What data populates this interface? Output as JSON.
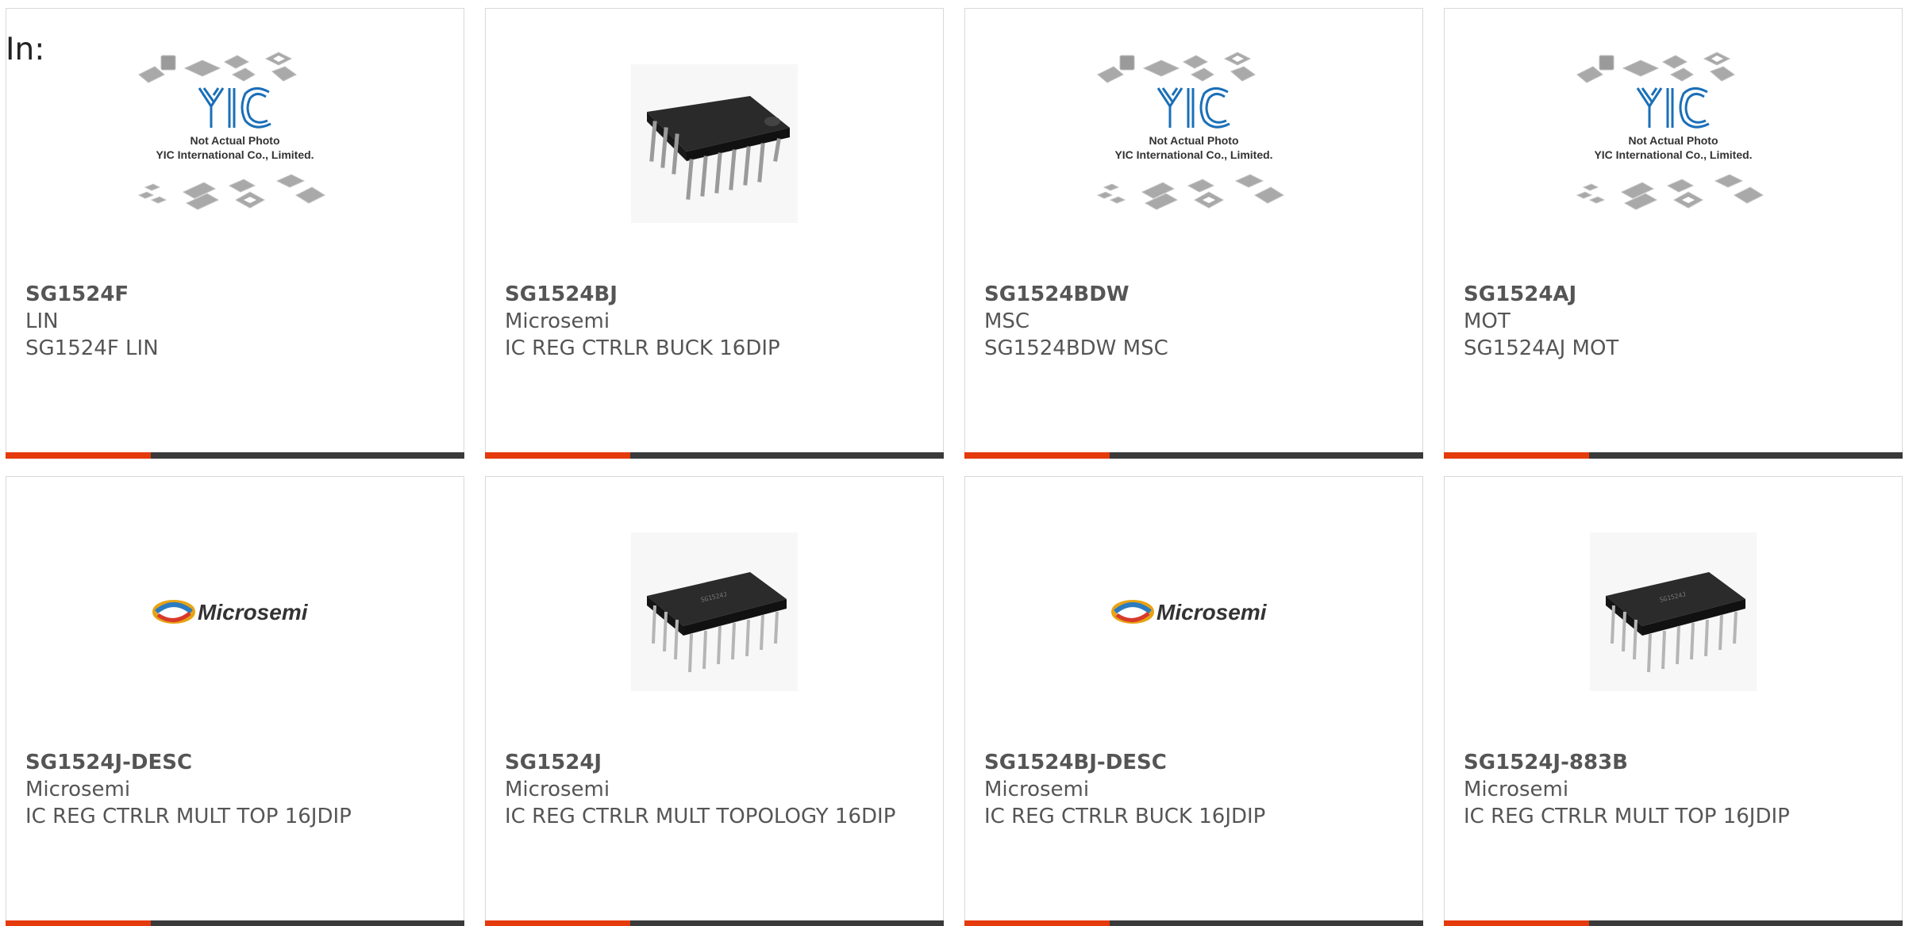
{
  "filter": {
    "label": "In:"
  },
  "colors": {
    "accent": "#e43a0c",
    "bar": "#3a3a3a",
    "text": "#555555",
    "border": "#d8d8d8",
    "yic_blue": "#1a6fb8"
  },
  "placeholder_text": {
    "line1": "Not Actual Photo",
    "line2": "YIC International Co., Limited.",
    "logo": "YIC"
  },
  "products": [
    {
      "part": "SG1524F",
      "maker": "LIN",
      "desc": "SG1524F LIN",
      "image": "not-actual-photo"
    },
    {
      "part": "SG1524BJ",
      "maker": "Microsemi",
      "desc": "IC REG CTRLR BUCK 16DIP",
      "image": "dip-chip-photo"
    },
    {
      "part": "SG1524BDW",
      "maker": "MSC",
      "desc": "SG1524BDW MSC",
      "image": "not-actual-photo"
    },
    {
      "part": "SG1524AJ",
      "maker": "MOT",
      "desc": "SG1524AJ MOT",
      "image": "not-actual-photo"
    },
    {
      "part": "SG1524J-DESC",
      "maker": "Microsemi",
      "desc": "IC REG CTRLR MULT TOP 16JDIP",
      "image": "microsemi-logo"
    },
    {
      "part": "SG1524J",
      "maker": "Microsemi",
      "desc": "IC REG CTRLR MULT TOPOLOGY 16DIP",
      "image": "ceramic-dip-photo"
    },
    {
      "part": "SG1524BJ-DESC",
      "maker": "Microsemi",
      "desc": "IC REG CTRLR BUCK 16JDIP",
      "image": "microsemi-logo"
    },
    {
      "part": "SG1524J-883B",
      "maker": "Microsemi",
      "desc": "IC REG CTRLR MULT TOP 16JDIP",
      "image": "ceramic-dip-photo"
    }
  ],
  "logo_text": {
    "microsemi": "Microsemi"
  }
}
